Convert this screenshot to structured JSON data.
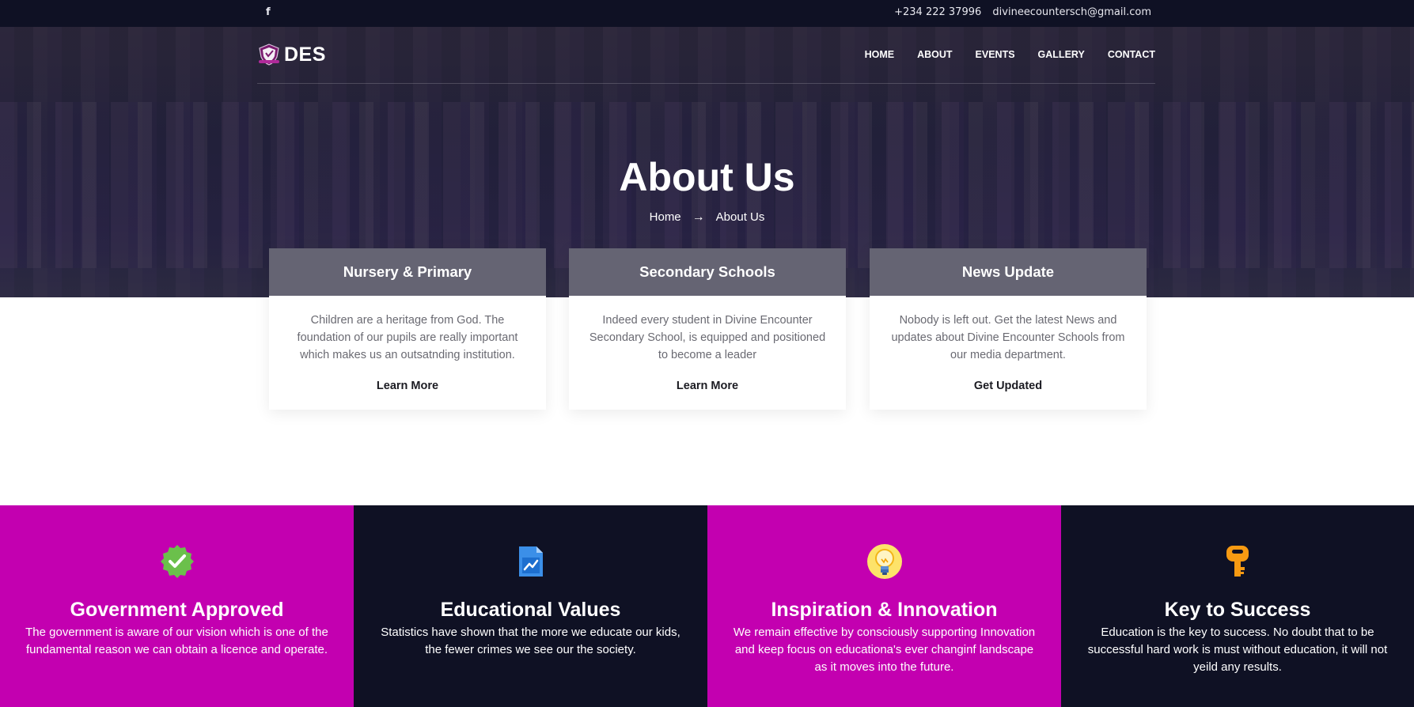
{
  "topbar": {
    "facebook_icon": "facebook-icon",
    "facebook_glyph": "f",
    "phone": "+234 222 37996",
    "email": "divineecountersch@gmail.com"
  },
  "nav": {
    "logo_text": "DES",
    "items": [
      "HOME",
      "ABOUT",
      "EVENTS",
      "GALLERY",
      "CONTACT"
    ]
  },
  "hero": {
    "title": "About Us",
    "breadcrumb": {
      "home": "Home",
      "arrow": "→",
      "current": "About Us"
    }
  },
  "cards": [
    {
      "title": "Nursery & Primary",
      "text": "Children are a heritage from God. The foundation of our pupils are really important which makes us an outsatnding institution.",
      "link": "Learn More"
    },
    {
      "title": "Secondary Schools",
      "text": "Indeed every student in Divine Encounter Secondary School, is equipped and positioned to become a leader",
      "link": "Learn More"
    },
    {
      "title": "News Update",
      "text": "Nobody is left out. Get the latest News and updates about Divine Encounter Schools from our media department.",
      "link": "Get Updated"
    }
  ],
  "features": [
    {
      "icon": "verified-badge-icon",
      "title": "Government Approved",
      "text": "The government is aware of our vision which is one of the fundamental reason we can obtain a licence and operate.",
      "bg": "#c300b0"
    },
    {
      "icon": "chart-document-icon",
      "title": "Educational Values",
      "text": "Statistics have shown that the more we educate our kids, the fewer crimes we see our the society.",
      "bg": "#0f1124"
    },
    {
      "icon": "lightbulb-icon",
      "title": "Inspiration & Innovation",
      "text": "We remain effective by consciously supporting Innovation and keep focus on educationa's ever changinf landscape as it moves into the future.",
      "bg": "#c300b0"
    },
    {
      "icon": "key-icon",
      "title": "Key to Success",
      "text": "Education is the key to success. No doubt that to be successful hard work is must without education, it will not yeild any results.",
      "bg": "#0f1124"
    }
  ],
  "colors": {
    "topbar": "#0f1124",
    "magenta": "#c300b0",
    "navy": "#0f1124",
    "card_head": "#504e60"
  }
}
